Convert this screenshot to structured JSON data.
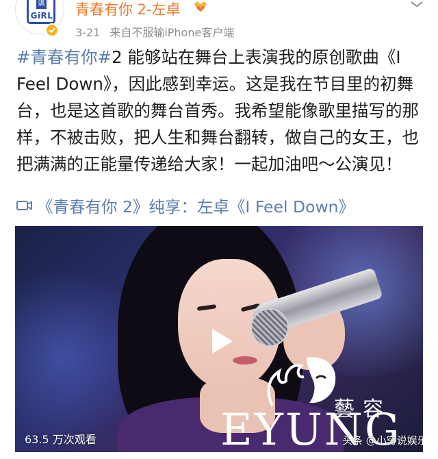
{
  "post": {
    "author": "青春有你 2-左卓",
    "member_icon": "crown-heart-icon",
    "date": "3-21",
    "source": "来自不服输iPhone客户端",
    "hashtag": "#青春有你#",
    "body_text": "2 能够站在舞台上表演我的原创歌曲《I Feel Down》，因此感到幸运。这是我在节目里的初舞台，也是这首歌的舞台首秀。我希望能像歌里描写的那样，不被击败，把人生和舞台翻转，做自己的女王，也把满满的正能量传递给大家！一起加油吧～公演见！"
  },
  "avatar": {
    "logo_text": "GiRL",
    "logo_mark": "飒"
  },
  "video_link": {
    "icon": "video-camera-icon",
    "text": "《青春有你 2》纯享：左卓《I Feel Down》"
  },
  "video": {
    "view_count": "63.5 万次观看",
    "play_icon": "play-icon",
    "watermark_cn": "藝容",
    "watermark_en": "EYUNG",
    "source_tag": "头条 @小穷说娱乐"
  },
  "colors": {
    "author_name": "#ee7a2b",
    "link": "#5a7eb0",
    "meta": "#8e8e8e",
    "verified_badge": "#f6b41c"
  }
}
